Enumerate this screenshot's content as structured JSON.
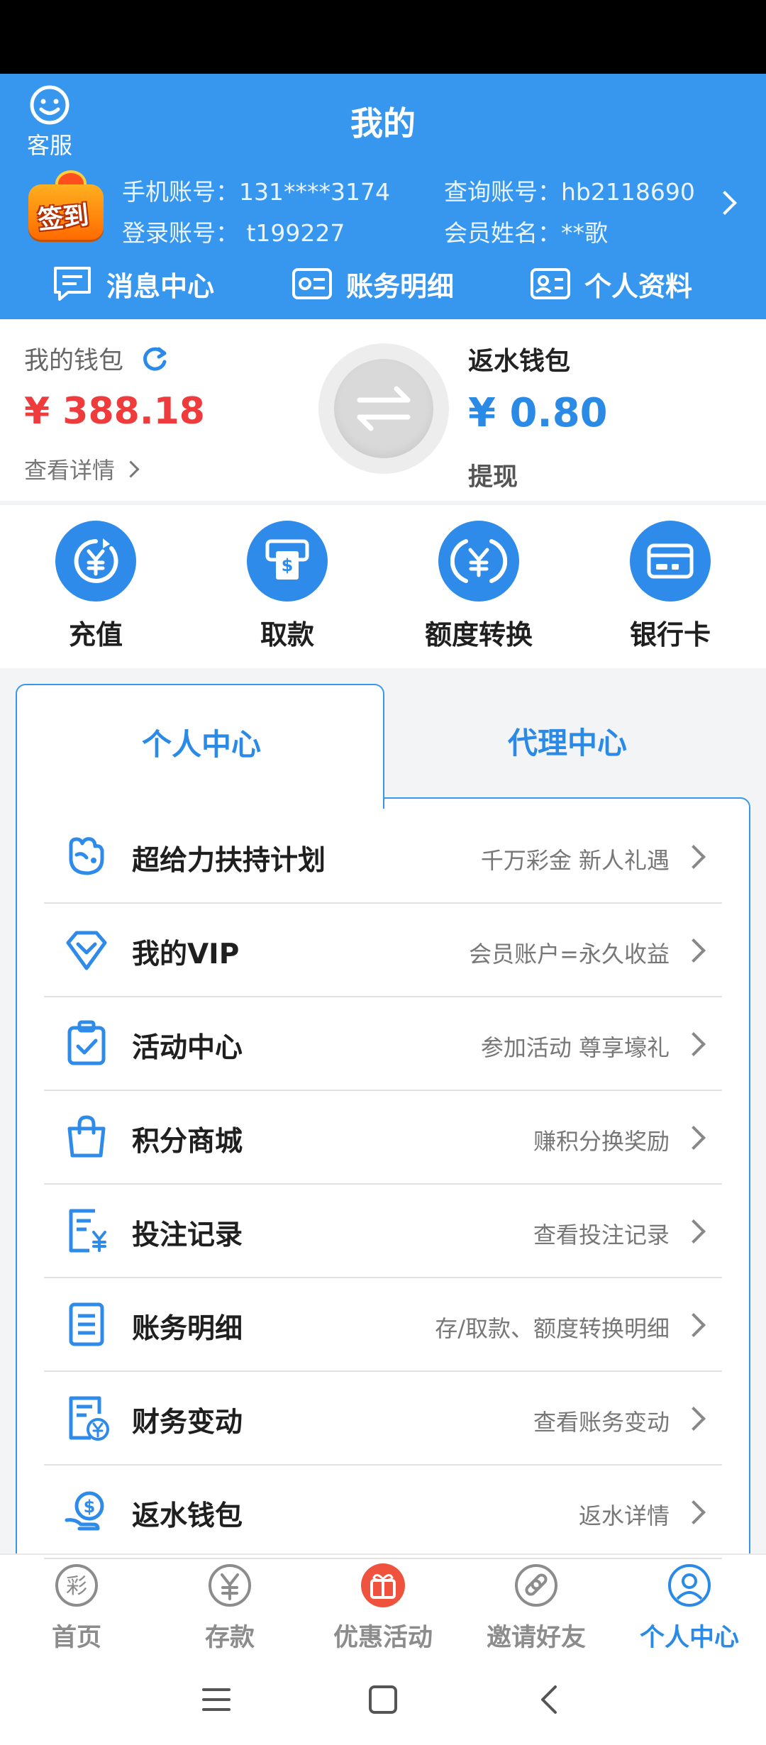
{
  "colors": {
    "primary": "#3796ee",
    "balance_red": "#ef3b3b",
    "balance_blue": "#2a8ae6"
  },
  "header": {
    "title": "我的",
    "customer_service": {
      "label": "客服",
      "icon": "smiley-face-icon"
    },
    "signin_badge": "签到",
    "account": {
      "phone": "手机账号：131****3174",
      "query": "查询账号：hb2118690",
      "login": "登录账号： t199227",
      "member_name": "会员姓名：**歌"
    },
    "quick_links": [
      {
        "label": "消息中心",
        "icon": "message-icon"
      },
      {
        "label": "账务明细",
        "icon": "statement-card-icon"
      },
      {
        "label": "个人资料",
        "icon": "profile-card-icon"
      }
    ]
  },
  "wallet": {
    "main": {
      "title": "我的钱包",
      "amount": "¥ 388.18",
      "detail_link": "查看详情"
    },
    "rebate": {
      "title": "返水钱包",
      "amount": "¥ 0.80",
      "withdraw": "提现"
    }
  },
  "actions": [
    {
      "label": "充值",
      "icon": "deposit-yuan-icon"
    },
    {
      "label": "取款",
      "icon": "atm-withdraw-icon"
    },
    {
      "label": "额度转换",
      "icon": "transfer-yuan-icon"
    },
    {
      "label": "银行卡",
      "icon": "bank-card-icon"
    }
  ],
  "tabs": [
    {
      "label": "个人中心",
      "active": true
    },
    {
      "label": "代理中心",
      "active": false
    }
  ],
  "menu": [
    {
      "label": "超给力扶持计划",
      "sub": "千万彩金 新人礼遇",
      "icon": "fist-icon"
    },
    {
      "label": "我的VIP",
      "sub": "会员账户=永久收益",
      "icon": "diamond-icon"
    },
    {
      "label": "活动中心",
      "sub": "参加活动 尊享壕礼",
      "icon": "clipboard-check-icon"
    },
    {
      "label": "积分商城",
      "sub": "赚积分换奖励",
      "icon": "shopping-bag-icon"
    },
    {
      "label": "投注记录",
      "sub": "查看投注记录",
      "icon": "bet-record-icon"
    },
    {
      "label": "账务明细",
      "sub": "存/取款、额度转换明细",
      "icon": "ledger-icon"
    },
    {
      "label": "财务变动",
      "sub": "查看账务变动",
      "icon": "finance-change-icon"
    },
    {
      "label": "返水钱包",
      "sub": "返水详情",
      "icon": "rebate-hand-icon"
    }
  ],
  "bottom_nav": [
    {
      "label": "首页",
      "icon": "lottery-icon",
      "active": false
    },
    {
      "label": "存款",
      "icon": "yuan-coin-icon",
      "active": false
    },
    {
      "label": "优惠活动",
      "icon": "gift-icon",
      "active": false
    },
    {
      "label": "邀请好友",
      "icon": "link-icon",
      "active": false
    },
    {
      "label": "个人中心",
      "icon": "user-icon",
      "active": true
    }
  ]
}
